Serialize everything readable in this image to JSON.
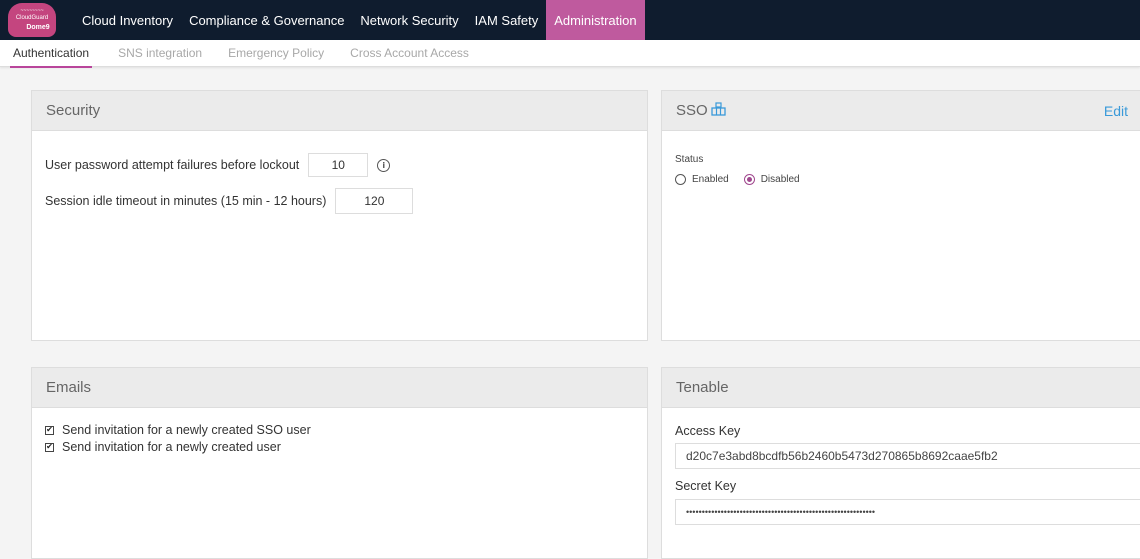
{
  "logo": {
    "line1": "~~~~~~~~",
    "line2": "CloudGuard",
    "line3": "Dome9"
  },
  "nav": {
    "items": [
      {
        "label": "Cloud Inventory"
      },
      {
        "label": "Compliance & Governance"
      },
      {
        "label": "Network Security"
      },
      {
        "label": "IAM Safety"
      },
      {
        "label": "Administration",
        "active": true
      }
    ]
  },
  "subtabs": [
    {
      "label": "Authentication",
      "active": true
    },
    {
      "label": "SNS integration"
    },
    {
      "label": "Emergency Policy"
    },
    {
      "label": "Cross Account Access"
    }
  ],
  "security": {
    "title": "Security",
    "lockout_label": "User password attempt failures before lockout",
    "lockout_value": "10",
    "timeout_label": "Session idle timeout in minutes (15 min - 12 hours)",
    "timeout_value": "120"
  },
  "sso": {
    "title": "SSO",
    "edit_label": "Edit",
    "status_label": "Status",
    "enabled_label": "Enabled",
    "disabled_label": "Disabled",
    "selected": "Disabled"
  },
  "emails": {
    "title": "Emails",
    "options": [
      {
        "label": "Send invitation for a newly created SSO user",
        "checked": true
      },
      {
        "label": "Send invitation for a newly created user",
        "checked": true
      }
    ]
  },
  "tenable": {
    "title": "Tenable",
    "access_key_label": "Access Key",
    "access_key_value": "d20c7e3abd8bcdfb56b2460b5473d270865b8692caae5fb2",
    "secret_key_label": "Secret Key",
    "secret_key_value": "••••••••••••••••••••••••••••••••••••••••••••••••••••••••••••"
  },
  "colors": {
    "topbar": "#0f1c2e",
    "active_nav": "#bf5a9e",
    "accent": "#b9459b",
    "link": "#3a9ad9"
  }
}
